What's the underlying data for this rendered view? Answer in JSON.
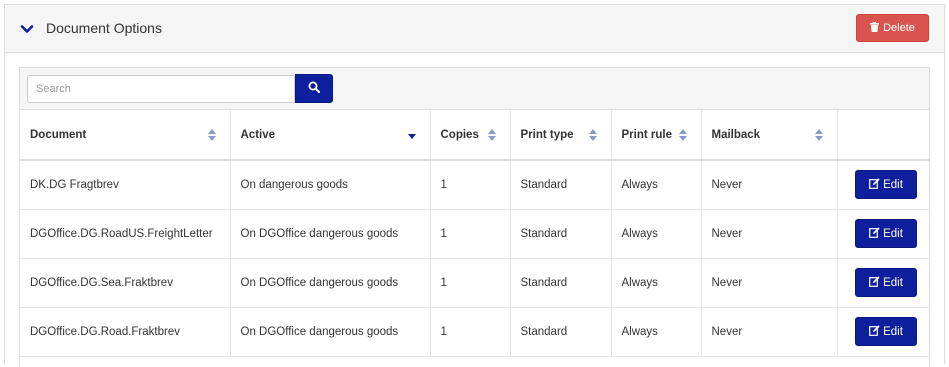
{
  "panel": {
    "title": "Document Options",
    "delete_label": "Delete"
  },
  "search": {
    "placeholder": "Search"
  },
  "table": {
    "columns": [
      "Document",
      "Active",
      "Copies",
      "Print type",
      "Print rule",
      "Mailback",
      ""
    ],
    "rows": [
      [
        "DK.DG Fragtbrev",
        "On dangerous goods",
        "1",
        "Standard",
        "Always",
        "Never"
      ],
      [
        "DGOffice.DG.RoadUS.FreightLetter",
        "On DGOffice dangerous goods",
        "1",
        "Standard",
        "Always",
        "Never"
      ],
      [
        "DGOffice.DG.Sea.Fraktbrev",
        "On DGOffice dangerous goods",
        "1",
        "Standard",
        "Always",
        "Never"
      ],
      [
        "DGOffice.DG.Road.Fraktbrev",
        "On DGOffice dangerous goods",
        "1",
        "Standard",
        "Always",
        "Never"
      ]
    ],
    "edit_label": "Edit"
  },
  "colors": {
    "primary": "#0d1f9c",
    "danger": "#d9534f",
    "header_bg": "#f5f5f5",
    "sort_icon": "#8a9ac8"
  },
  "icons": {
    "collapse": "chevron-down-icon",
    "delete": "trash-icon",
    "search": "search-icon",
    "sort": "sort-icon",
    "sort_active": "sort-desc-icon",
    "edit": "edit-icon"
  }
}
